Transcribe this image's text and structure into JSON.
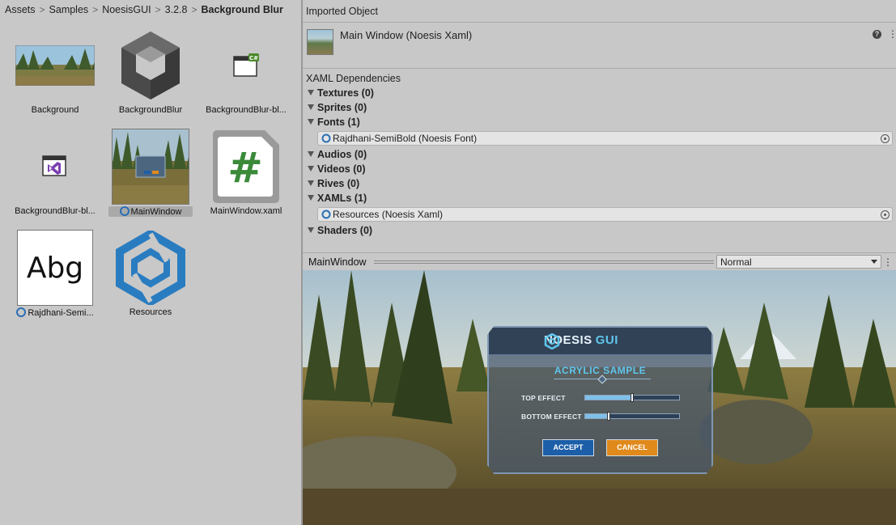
{
  "breadcrumb": {
    "items": [
      "Assets",
      "Samples",
      "NoesisGUI",
      "3.2.8"
    ],
    "current": "Background Blur"
  },
  "assets": [
    {
      "label": "Background",
      "icon": "image-thumbnail"
    },
    {
      "label": "BackgroundBlur",
      "icon": "unity-scene-icon"
    },
    {
      "label": "BackgroundBlur-bl...",
      "icon": "csharp-script-icon"
    },
    {
      "label": "BackgroundBlur-bl...",
      "icon": "visual-studio-icon"
    },
    {
      "label": "MainWindow",
      "icon": "xaml-preview-thumbnail",
      "selected": true
    },
    {
      "label": "MainWindow.xaml",
      "icon": "hash-file-icon"
    },
    {
      "label": "Rajdhani-Semi...",
      "icon": "font-preview-icon",
      "glyph": "Abg"
    },
    {
      "label": "Resources",
      "icon": "noesis-logo-icon"
    }
  ],
  "inspector": {
    "title": "Imported Object",
    "object_name": "Main Window (Noesis Xaml)",
    "help": "?",
    "dependencies_title": "XAML Dependencies",
    "groups": {
      "textures": "Textures (0)",
      "sprites": "Sprites (0)",
      "fonts": "Fonts (1)",
      "font_item": "Rajdhani-SemiBold (Noesis Font)",
      "audios": "Audios (0)",
      "videos": "Videos (0)",
      "rives": "Rives (0)",
      "xamls": "XAMLs (1)",
      "xaml_item": "Resources (Noesis Xaml)",
      "shaders": "Shaders (0)"
    }
  },
  "preview": {
    "title": "MainWindow",
    "mode": "Normal",
    "dialog": {
      "logo_main": "NOESIS",
      "logo_accent": "GUI",
      "title": "ACRYLIC SAMPLE",
      "top_effect_label": "TOP EFFECT",
      "top_effect_value": 0.5,
      "bottom_effect_label": "BOTTOM EFFECT",
      "bottom_effect_value": 0.25,
      "accept": "ACCEPT",
      "cancel": "CANCEL"
    }
  },
  "colors": {
    "panel_bg": "#c8c8c8",
    "accept": "#1c5ea8",
    "cancel": "#e08a1c",
    "accent": "#5fc6ee"
  }
}
